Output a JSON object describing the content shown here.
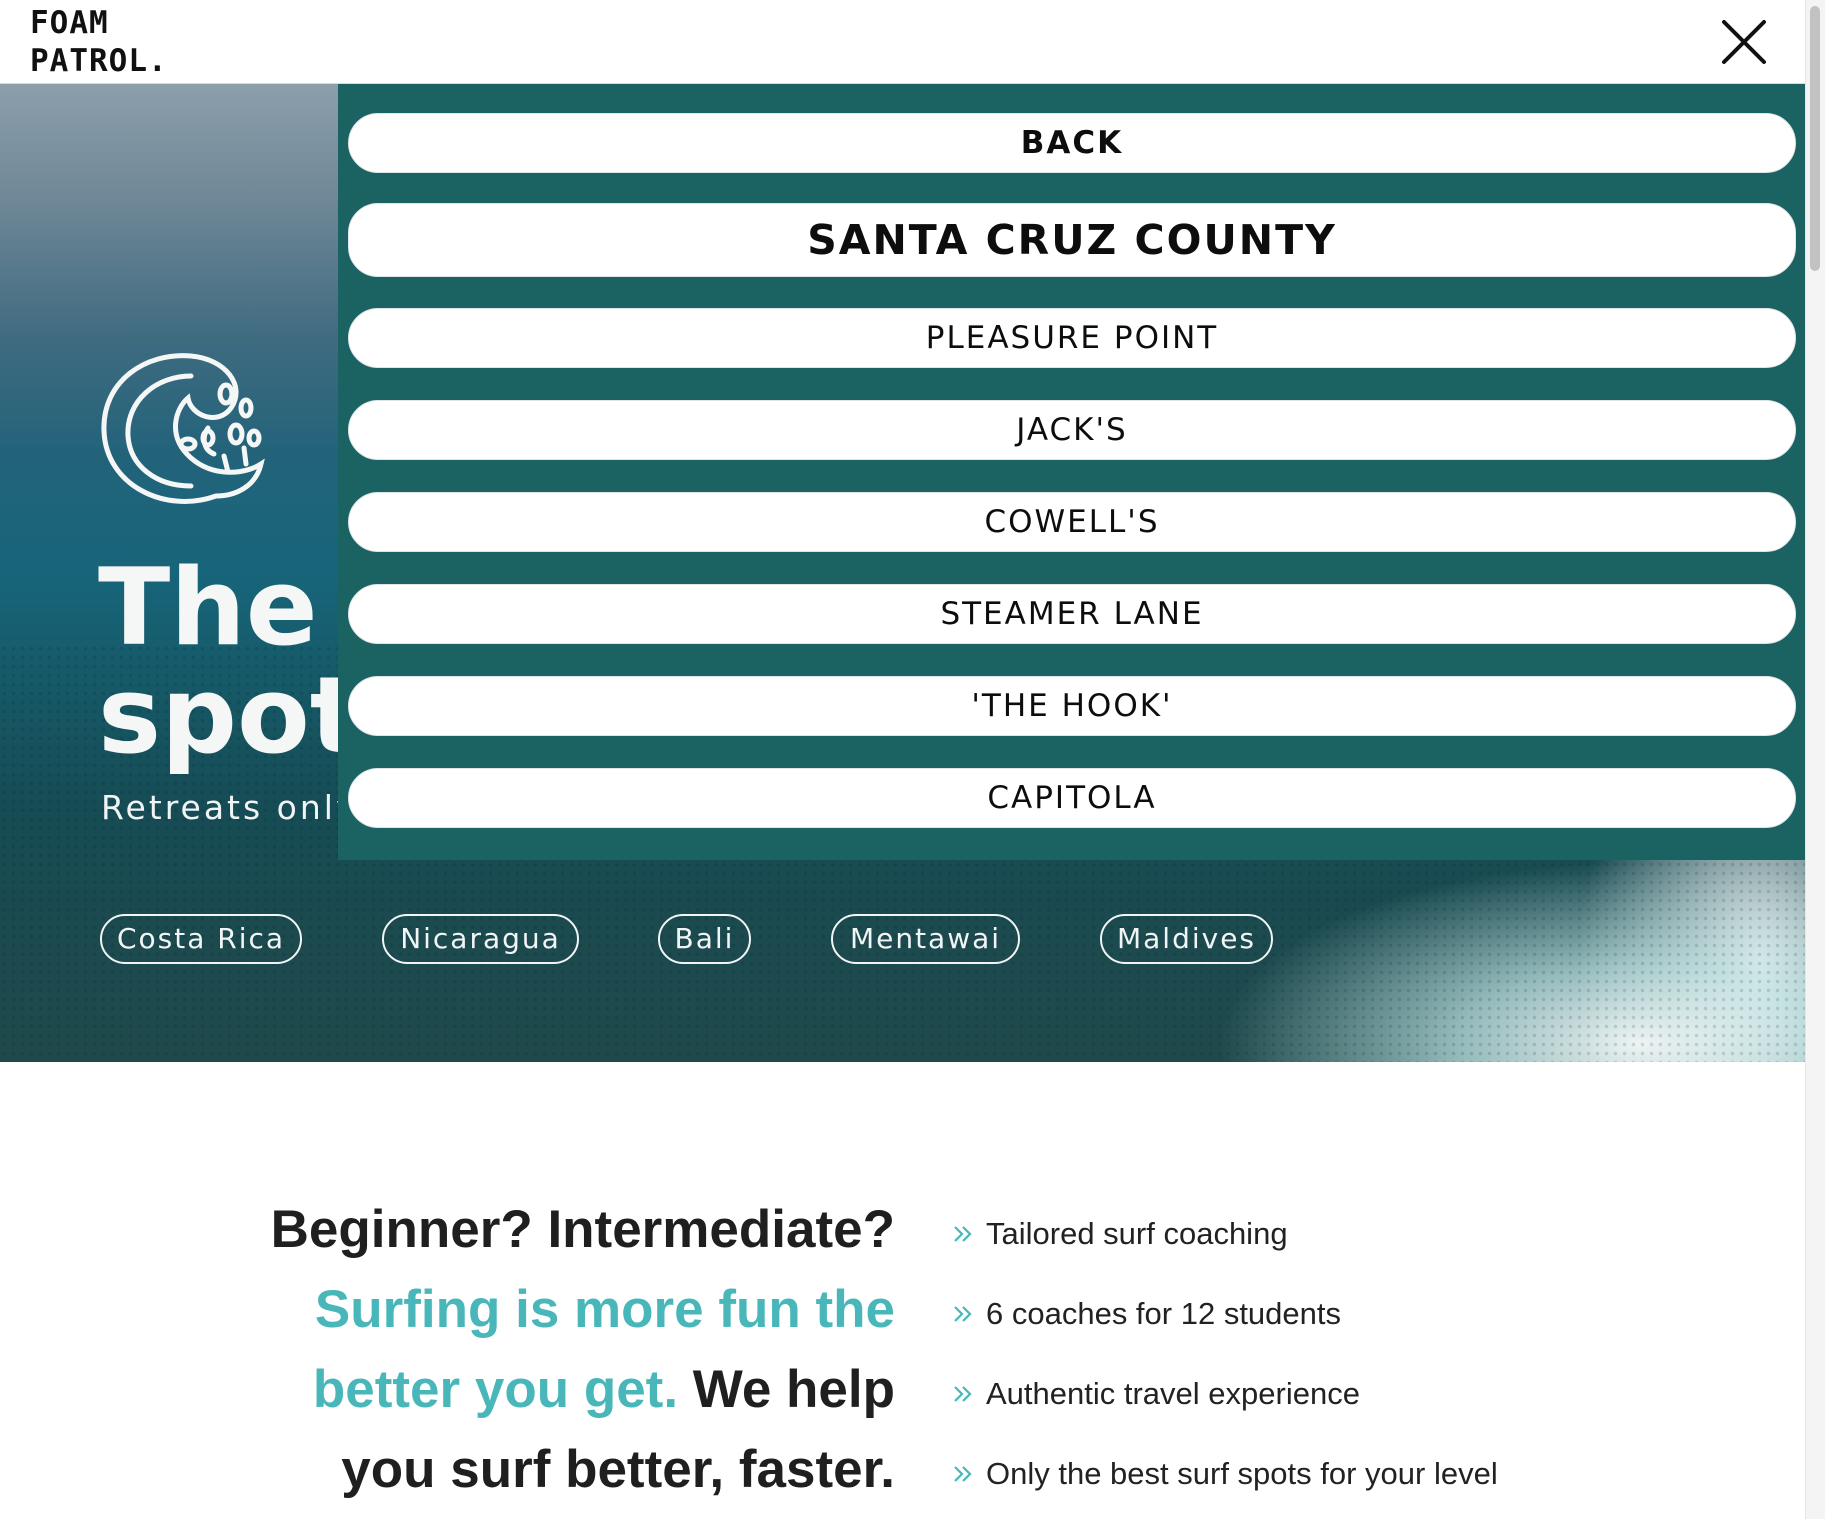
{
  "header": {
    "logo_line1": "FOAM",
    "logo_line2": "PATROL.",
    "close_icon": "close-x-icon"
  },
  "hero": {
    "logo_icon": "wave-splash-icon",
    "title_line1": "The",
    "title_line2": "spot",
    "subtitle": "Retreats only",
    "destinations": [
      "Costa Rica",
      "Nicaragua",
      "Bali",
      "Mentawai",
      "Maldives"
    ]
  },
  "dropdown": {
    "back_label": "BACK",
    "region_label": "SANTA CRUZ COUNTY",
    "spots": [
      "PLEASURE POINT",
      "JACK'S",
      "COWELL'S",
      "STEAMER LANE",
      "'THE HOOK'",
      "CAPITOLA"
    ],
    "panel_color": "#1b6263"
  },
  "intro": {
    "line_dark1": "Beginner? Intermediate?",
    "line_accent": "Surfing is more fun the better you get.",
    "line_dark2": "We help you surf better, faster.",
    "accent_color": "#49b7b9"
  },
  "features": {
    "icon": "double-chevron-right-icon",
    "items": [
      "Tailored surf coaching",
      "6 coaches for 12 students",
      "Authentic travel experience",
      "Only the best surf spots for your level"
    ]
  }
}
